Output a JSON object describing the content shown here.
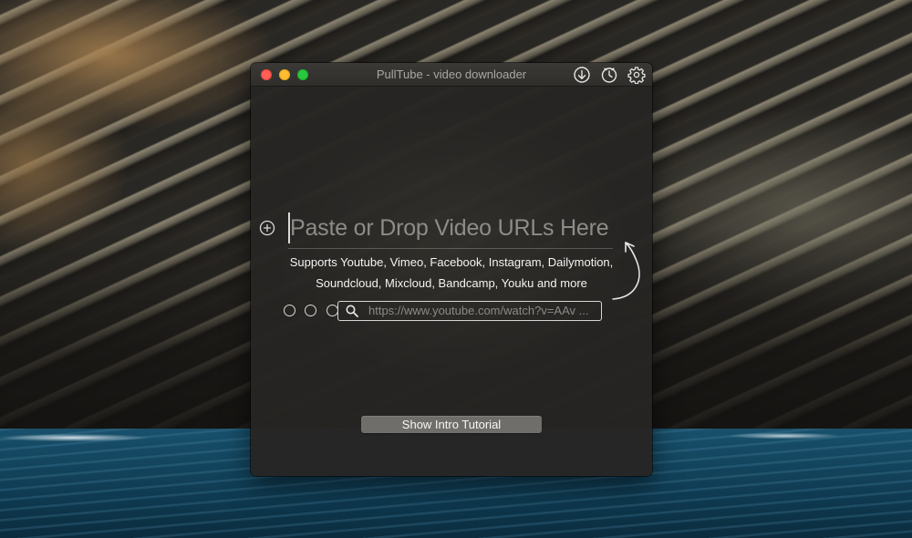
{
  "window": {
    "title": "PullTube - video downloader"
  },
  "toolbar": {
    "icons": [
      "download-icon",
      "history-clock-icon",
      "gear-icon"
    ]
  },
  "main": {
    "url_placeholder": "Paste or Drop Video URLs Here",
    "supports_line1": "Supports Youtube, Vimeo, Facebook, Instagram, Dailymotion,",
    "supports_line2": "Soundcloud, Mixcloud, Bandcamp, Youku and more",
    "example_url": "https://www.youtube.com/watch?v=AAv ...",
    "tutorial_button": "Show Intro Tutorial"
  },
  "colors": {
    "close": "#fe5f57",
    "minimize": "#febc2e",
    "maximize": "#28c840",
    "window_bg": "#262523",
    "button_bg": "#6f6e6a"
  }
}
